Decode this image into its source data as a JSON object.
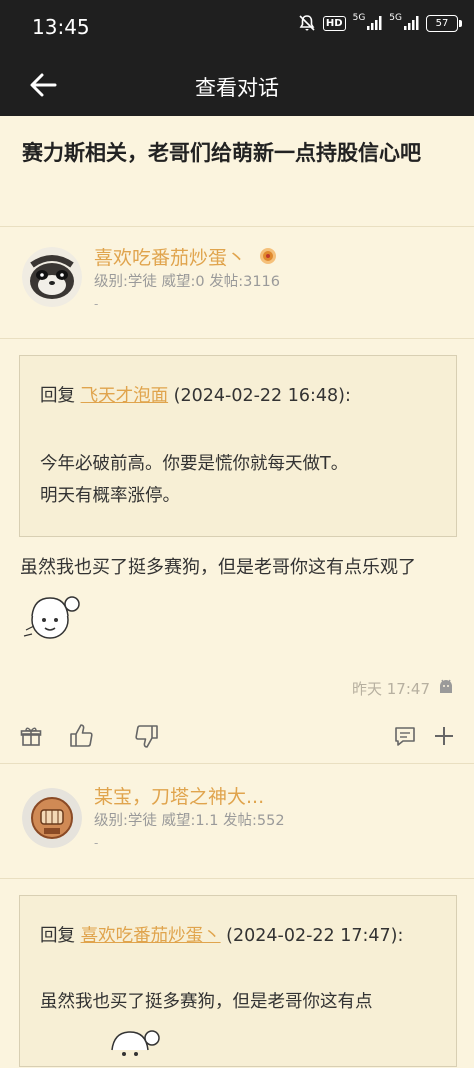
{
  "status": {
    "time": "13:45",
    "hd": "HD",
    "sig1": "5G",
    "sig2": "5G",
    "battery": "57"
  },
  "nav": {
    "title": "查看对话"
  },
  "thread": {
    "title": "赛力斯相关，老哥们给萌新一点持股信心吧"
  },
  "posts": [
    {
      "username": "喜欢吃番茄炒蛋丶",
      "meta": "级别:学徒 威望:0 发帖:3116",
      "sig": "-",
      "quote_prefix": "回复",
      "quote_user": "飞天才泡面",
      "quote_time": "(2024-02-22 16:48):",
      "quote_lines": [
        "今年必破前高。你要是慌你就每天做T。",
        "明天有概率涨停。"
      ],
      "body": "虽然我也买了挺多赛狗，但是老哥你这有点乐观了",
      "time": "昨天 17:47"
    },
    {
      "username": "某宝，刀塔之神大...",
      "meta": "级别:学徒 威望:1.1 发帖:552",
      "sig": "-",
      "quote_prefix": "回复",
      "quote_user": "喜欢吃番茄炒蛋丶",
      "quote_time": "(2024-02-22 17:47):",
      "quote_lines": [
        "虽然我也买了挺多赛狗，但是老哥你这有点"
      ]
    }
  ],
  "colors": {
    "accent": "#e0a44d",
    "bg": "#fbf4de",
    "bar": "#1f1f1f"
  }
}
